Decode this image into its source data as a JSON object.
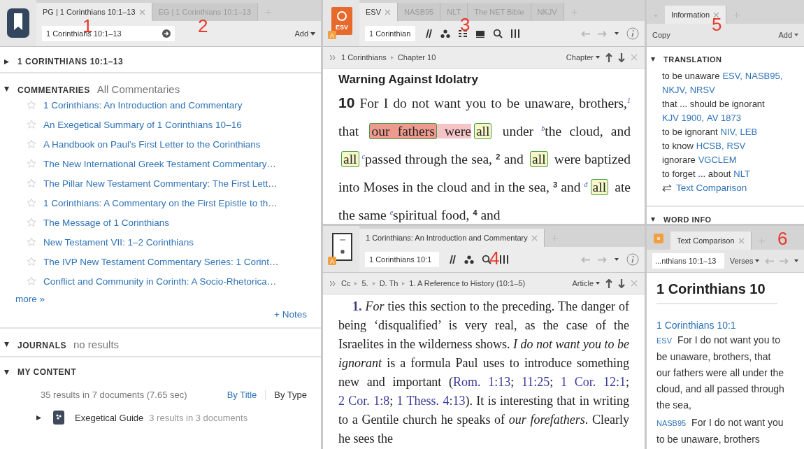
{
  "annotations": [
    "1",
    "2",
    "3",
    "4",
    "5",
    "6"
  ],
  "guide": {
    "tabs": [
      {
        "label": "PG | 1 Corinthians 10:1–13",
        "selected": true
      },
      {
        "label": "EG | 1 Corinthians 10:1–13",
        "selected": false
      }
    ],
    "reference": "1 Corinthians 10:1–13",
    "add_label": "Add",
    "passage_section": {
      "title": "1 CORINTHIANS 10:1–13",
      "expanded": false
    },
    "commentaries": {
      "title": "COMMENTARIES",
      "subtitle": "All Commentaries",
      "expanded": true,
      "items": [
        "1 Corinthians: An Introduction and Commentary",
        "An Exegetical Summary of 1 Corinthians 10–16",
        "A Handbook on Paul’s First Letter to the Corinthians",
        "The New International Greek Testament Commentary…",
        "The Pillar New Testament Commentary: The First Lett…",
        "1 Corinthians: A Commentary on the First Epistle to th…",
        "The Message of 1 Corinthians",
        "New Testament VII: 1–2 Corinthians",
        "The IVP New Testament Commentary Series: 1 Corint…",
        "Conflict and Community in Corinth: A Socio-Rhetorica…"
      ],
      "more": "more »",
      "notes": "+ Notes"
    },
    "journals": {
      "title": "JOURNALS",
      "subtitle": "no results",
      "expanded": true
    },
    "my_content": {
      "title": "MY CONTENT",
      "expanded": true,
      "summary": "35 results in 7 documents (7.65 sec)",
      "sort_options": [
        {
          "label": "By Title",
          "selected": false
        },
        {
          "label": "By Type",
          "selected": true
        }
      ],
      "results": [
        {
          "title": "Exegetical Guide",
          "detail": "3 results in 3 documents",
          "expanded": false
        }
      ]
    }
  },
  "bible": {
    "tabs": [
      {
        "label": "ESV",
        "selected": true
      },
      {
        "label": "NASB95",
        "selected": false
      },
      {
        "label": "NLT",
        "selected": false
      },
      {
        "label": "The NET Bible",
        "selected": false
      },
      {
        "label": "NKJV",
        "selected": false
      }
    ],
    "icon_label": "ESV",
    "badge": "A",
    "reference": "1 Corinthian",
    "breadcrumb": [
      "1 Corinthians",
      "Chapter 10"
    ],
    "nav_menu": "Chapter",
    "heading": "Warning Against Idolatry",
    "segments": [
      {
        "kind": "chapter",
        "text": "10"
      },
      {
        "kind": "text",
        "text": " For I do not want you to be unaware, brothers,"
      },
      {
        "kind": "note",
        "text": "1"
      },
      {
        "kind": "text",
        "text": " that "
      },
      {
        "kind": "boxed-red",
        "text": "our fathers"
      },
      {
        "kind": "highlight",
        "text": " were"
      },
      {
        "kind": "boxed",
        "text": "all"
      },
      {
        "kind": "text",
        "text": " under "
      },
      {
        "kind": "note",
        "text": "b"
      },
      {
        "kind": "text",
        "text": "the cloud, and "
      },
      {
        "kind": "boxed",
        "text": "all"
      },
      {
        "kind": "note",
        "text": "c"
      },
      {
        "kind": "text",
        "text": "passed through the sea, "
      },
      {
        "kind": "verse",
        "text": "2"
      },
      {
        "kind": "text",
        "text": " and "
      },
      {
        "kind": "boxed",
        "text": "all"
      },
      {
        "kind": "text",
        "text": " were baptized into Moses in the cloud and in the sea, "
      },
      {
        "kind": "verse",
        "text": "3"
      },
      {
        "kind": "text",
        "text": " and "
      },
      {
        "kind": "note",
        "text": "d"
      },
      {
        "kind": "boxed",
        "text": "all"
      },
      {
        "kind": "text",
        "text": " ate the same "
      },
      {
        "kind": "note",
        "text": "e"
      },
      {
        "kind": "text",
        "text": "spiritual food, "
      },
      {
        "kind": "verse",
        "text": "4"
      },
      {
        "kind": "text",
        "text": " and"
      }
    ]
  },
  "commentary": {
    "tabs": [
      {
        "label": "1 Corinthians: An Introduction and Commentary",
        "selected": true
      }
    ],
    "badge": "A",
    "reference": "1 Corinthians 10:1",
    "breadcrumb": [
      "Cc",
      "5.",
      "D. Th",
      "1. A Reference to History (10:1–5)"
    ],
    "nav_menu": "Article",
    "segments": [
      {
        "kind": "number",
        "text": "1."
      },
      {
        "kind": "text",
        "text": " *For* ties this section to the preceding. The danger of being ‘disqualified’ is very real, as the case of the Israelites in the wilderness shows. *I do not want you to be ignorant* is a formula Paul uses to introduce something new and important ("
      },
      {
        "kind": "link",
        "text": "Rom. 1:13"
      },
      {
        "kind": "text",
        "text": "; "
      },
      {
        "kind": "link",
        "text": "11:25"
      },
      {
        "kind": "text",
        "text": "; "
      },
      {
        "kind": "link",
        "text": "1 Cor. 12:1"
      },
      {
        "kind": "text",
        "text": "; "
      },
      {
        "kind": "link",
        "text": "2 Cor. 1:8"
      },
      {
        "kind": "text",
        "text": "; "
      },
      {
        "kind": "link",
        "text": "1 Thess. 4:13"
      },
      {
        "kind": "text",
        "text": "). It is interesting that in writing to a Gentile church he speaks of *our forefathers*. Clearly he sees the"
      }
    ]
  },
  "info": {
    "tabs": [
      {
        "label": "Information",
        "selected": true
      }
    ],
    "copy_label": "Copy",
    "add_label": "Add",
    "translation": {
      "title": "TRANSLATION",
      "expanded": true,
      "renderings": [
        {
          "text": "to be unaware",
          "versions": [
            "ESV,",
            "NASB95,",
            "NKJV,",
            "NRSV"
          ]
        },
        {
          "text": "that ... should be ignorant",
          "versions": [
            "KJV 1900,",
            "AV 1873"
          ]
        },
        {
          "text": "to be ignorant",
          "versions": [
            "NIV,",
            "LEB"
          ]
        },
        {
          "text": "to know",
          "versions": [
            "HCSB,",
            "RSV"
          ]
        },
        {
          "text": "ignorare",
          "versions": [
            "VGCLEM"
          ]
        },
        {
          "text": "to forget ... about",
          "versions": [
            "NLT"
          ]
        }
      ],
      "comparison_link": "Text Comparison"
    },
    "word_info": {
      "title": "WORD INFO",
      "expanded": true
    }
  },
  "comparison": {
    "tabs": [
      {
        "label": "Text Comparison",
        "selected": true
      }
    ],
    "reference": "...nthians 10:1–13",
    "nav_menu": "Verses",
    "heading": "1 Corinthians 10",
    "verse_ref": "1 Corinthians 10:1",
    "entries": [
      {
        "version": "ESV",
        "text": "For I do not want you to be unaware, brothers, that our fathers were all under the cloud, and all passed through the sea,"
      },
      {
        "version": "NASB95",
        "text": "For I do not want you to be unaware, brothers"
      }
    ]
  }
}
